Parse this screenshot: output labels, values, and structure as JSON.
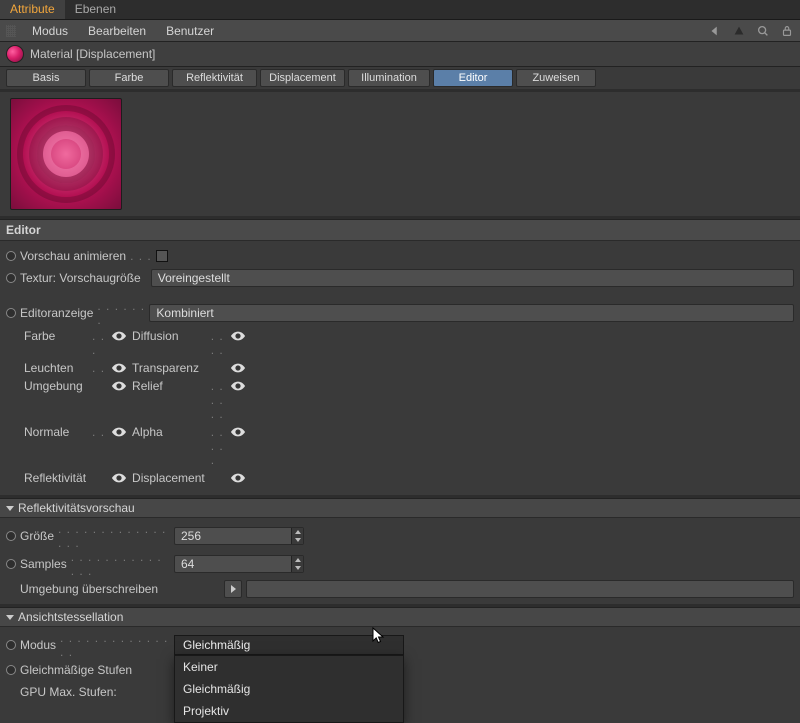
{
  "topTabs": {
    "attribute": "Attribute",
    "ebenen": "Ebenen"
  },
  "menubar": {
    "modus": "Modus",
    "bearbeiten": "Bearbeiten",
    "benutzer": "Benutzer"
  },
  "material": {
    "title": "Material [Displacement]"
  },
  "tabs": {
    "basis": "Basis",
    "farbe": "Farbe",
    "reflekt": "Reflektivität",
    "displacement": "Displacement",
    "illumination": "Illumination",
    "editor": "Editor",
    "zuweisen": "Zuweisen"
  },
  "editor": {
    "section": "Editor",
    "animatePreview": "Vorschau animieren",
    "texPreviewSize": "Textur: Vorschaugröße",
    "texPreviewSizeValue": "Voreingestellt",
    "editorDisplay": "Editoranzeige",
    "editorDisplayValue": "Kombiniert",
    "channels": {
      "farbe": "Farbe",
      "diffusion": "Diffusion",
      "leuchten": "Leuchten",
      "transparenz": "Transparenz",
      "umgebung": "Umgebung",
      "relief": "Relief",
      "normale": "Normale",
      "alpha": "Alpha",
      "reflektivitat": "Reflektivität",
      "displacement": "Displacement"
    }
  },
  "reflPreview": {
    "section": "Reflektivitätsvorschau",
    "size": "Größe",
    "sizeValue": "256",
    "samples": "Samples",
    "samplesValue": "64",
    "envOverride": "Umgebung überschreiben"
  },
  "tessellation": {
    "section": "Ansichtstessellation",
    "mode": "Modus",
    "modeValue": "Gleichmäßig",
    "uniformSteps": "Gleichmäßige Stufen",
    "gpuMaxSteps": "GPU Max. Stufen:",
    "options": {
      "none": "Keiner",
      "uniform": "Gleichmäßig",
      "projective": "Projektiv"
    }
  }
}
